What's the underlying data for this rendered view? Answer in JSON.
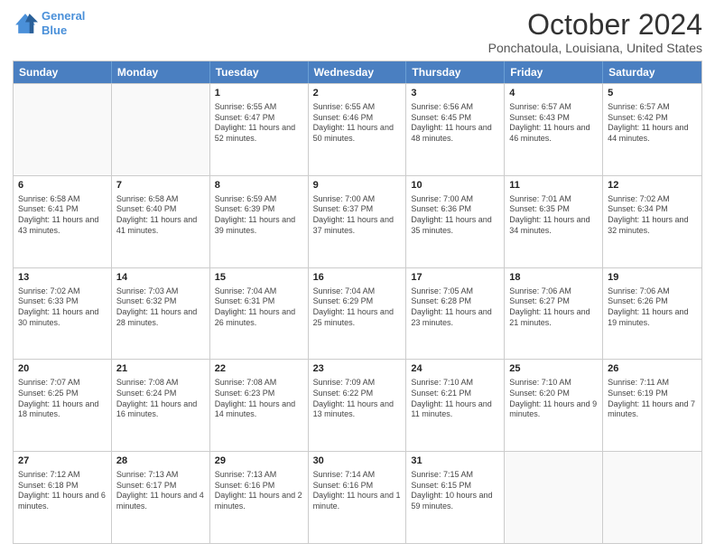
{
  "header": {
    "logo_line1": "General",
    "logo_line2": "Blue",
    "title": "October 2024",
    "subtitle": "Ponchatoula, Louisiana, United States"
  },
  "days_of_week": [
    "Sunday",
    "Monday",
    "Tuesday",
    "Wednesday",
    "Thursday",
    "Friday",
    "Saturday"
  ],
  "weeks": [
    [
      {
        "num": "",
        "sunrise": "",
        "sunset": "",
        "daylight": ""
      },
      {
        "num": "",
        "sunrise": "",
        "sunset": "",
        "daylight": ""
      },
      {
        "num": "1",
        "sunrise": "Sunrise: 6:55 AM",
        "sunset": "Sunset: 6:47 PM",
        "daylight": "Daylight: 11 hours and 52 minutes."
      },
      {
        "num": "2",
        "sunrise": "Sunrise: 6:55 AM",
        "sunset": "Sunset: 6:46 PM",
        "daylight": "Daylight: 11 hours and 50 minutes."
      },
      {
        "num": "3",
        "sunrise": "Sunrise: 6:56 AM",
        "sunset": "Sunset: 6:45 PM",
        "daylight": "Daylight: 11 hours and 48 minutes."
      },
      {
        "num": "4",
        "sunrise": "Sunrise: 6:57 AM",
        "sunset": "Sunset: 6:43 PM",
        "daylight": "Daylight: 11 hours and 46 minutes."
      },
      {
        "num": "5",
        "sunrise": "Sunrise: 6:57 AM",
        "sunset": "Sunset: 6:42 PM",
        "daylight": "Daylight: 11 hours and 44 minutes."
      }
    ],
    [
      {
        "num": "6",
        "sunrise": "Sunrise: 6:58 AM",
        "sunset": "Sunset: 6:41 PM",
        "daylight": "Daylight: 11 hours and 43 minutes."
      },
      {
        "num": "7",
        "sunrise": "Sunrise: 6:58 AM",
        "sunset": "Sunset: 6:40 PM",
        "daylight": "Daylight: 11 hours and 41 minutes."
      },
      {
        "num": "8",
        "sunrise": "Sunrise: 6:59 AM",
        "sunset": "Sunset: 6:39 PM",
        "daylight": "Daylight: 11 hours and 39 minutes."
      },
      {
        "num": "9",
        "sunrise": "Sunrise: 7:00 AM",
        "sunset": "Sunset: 6:37 PM",
        "daylight": "Daylight: 11 hours and 37 minutes."
      },
      {
        "num": "10",
        "sunrise": "Sunrise: 7:00 AM",
        "sunset": "Sunset: 6:36 PM",
        "daylight": "Daylight: 11 hours and 35 minutes."
      },
      {
        "num": "11",
        "sunrise": "Sunrise: 7:01 AM",
        "sunset": "Sunset: 6:35 PM",
        "daylight": "Daylight: 11 hours and 34 minutes."
      },
      {
        "num": "12",
        "sunrise": "Sunrise: 7:02 AM",
        "sunset": "Sunset: 6:34 PM",
        "daylight": "Daylight: 11 hours and 32 minutes."
      }
    ],
    [
      {
        "num": "13",
        "sunrise": "Sunrise: 7:02 AM",
        "sunset": "Sunset: 6:33 PM",
        "daylight": "Daylight: 11 hours and 30 minutes."
      },
      {
        "num": "14",
        "sunrise": "Sunrise: 7:03 AM",
        "sunset": "Sunset: 6:32 PM",
        "daylight": "Daylight: 11 hours and 28 minutes."
      },
      {
        "num": "15",
        "sunrise": "Sunrise: 7:04 AM",
        "sunset": "Sunset: 6:31 PM",
        "daylight": "Daylight: 11 hours and 26 minutes."
      },
      {
        "num": "16",
        "sunrise": "Sunrise: 7:04 AM",
        "sunset": "Sunset: 6:29 PM",
        "daylight": "Daylight: 11 hours and 25 minutes."
      },
      {
        "num": "17",
        "sunrise": "Sunrise: 7:05 AM",
        "sunset": "Sunset: 6:28 PM",
        "daylight": "Daylight: 11 hours and 23 minutes."
      },
      {
        "num": "18",
        "sunrise": "Sunrise: 7:06 AM",
        "sunset": "Sunset: 6:27 PM",
        "daylight": "Daylight: 11 hours and 21 minutes."
      },
      {
        "num": "19",
        "sunrise": "Sunrise: 7:06 AM",
        "sunset": "Sunset: 6:26 PM",
        "daylight": "Daylight: 11 hours and 19 minutes."
      }
    ],
    [
      {
        "num": "20",
        "sunrise": "Sunrise: 7:07 AM",
        "sunset": "Sunset: 6:25 PM",
        "daylight": "Daylight: 11 hours and 18 minutes."
      },
      {
        "num": "21",
        "sunrise": "Sunrise: 7:08 AM",
        "sunset": "Sunset: 6:24 PM",
        "daylight": "Daylight: 11 hours and 16 minutes."
      },
      {
        "num": "22",
        "sunrise": "Sunrise: 7:08 AM",
        "sunset": "Sunset: 6:23 PM",
        "daylight": "Daylight: 11 hours and 14 minutes."
      },
      {
        "num": "23",
        "sunrise": "Sunrise: 7:09 AM",
        "sunset": "Sunset: 6:22 PM",
        "daylight": "Daylight: 11 hours and 13 minutes."
      },
      {
        "num": "24",
        "sunrise": "Sunrise: 7:10 AM",
        "sunset": "Sunset: 6:21 PM",
        "daylight": "Daylight: 11 hours and 11 minutes."
      },
      {
        "num": "25",
        "sunrise": "Sunrise: 7:10 AM",
        "sunset": "Sunset: 6:20 PM",
        "daylight": "Daylight: 11 hours and 9 minutes."
      },
      {
        "num": "26",
        "sunrise": "Sunrise: 7:11 AM",
        "sunset": "Sunset: 6:19 PM",
        "daylight": "Daylight: 11 hours and 7 minutes."
      }
    ],
    [
      {
        "num": "27",
        "sunrise": "Sunrise: 7:12 AM",
        "sunset": "Sunset: 6:18 PM",
        "daylight": "Daylight: 11 hours and 6 minutes."
      },
      {
        "num": "28",
        "sunrise": "Sunrise: 7:13 AM",
        "sunset": "Sunset: 6:17 PM",
        "daylight": "Daylight: 11 hours and 4 minutes."
      },
      {
        "num": "29",
        "sunrise": "Sunrise: 7:13 AM",
        "sunset": "Sunset: 6:16 PM",
        "daylight": "Daylight: 11 hours and 2 minutes."
      },
      {
        "num": "30",
        "sunrise": "Sunrise: 7:14 AM",
        "sunset": "Sunset: 6:16 PM",
        "daylight": "Daylight: 11 hours and 1 minute."
      },
      {
        "num": "31",
        "sunrise": "Sunrise: 7:15 AM",
        "sunset": "Sunset: 6:15 PM",
        "daylight": "Daylight: 10 hours and 59 minutes."
      },
      {
        "num": "",
        "sunrise": "",
        "sunset": "",
        "daylight": ""
      },
      {
        "num": "",
        "sunrise": "",
        "sunset": "",
        "daylight": ""
      }
    ]
  ]
}
